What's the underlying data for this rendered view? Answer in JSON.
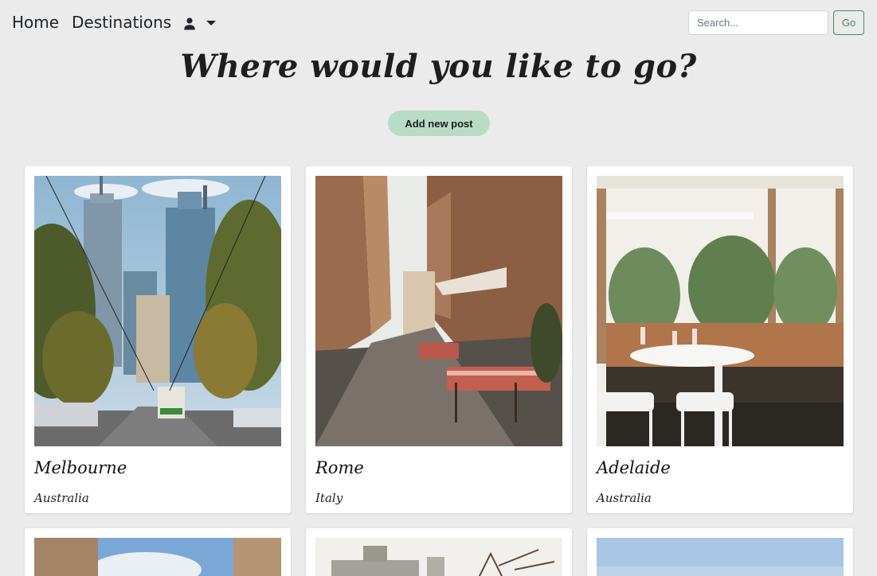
{
  "nav": {
    "home_label": "Home",
    "destinations_label": "Destinations",
    "user_icon": "person-icon",
    "caret_icon": "caret-down-icon"
  },
  "search": {
    "placeholder": "Search...",
    "value": "",
    "button_label": "Go"
  },
  "header": {
    "title": "Where would you like to go?",
    "add_post_label": "Add new post"
  },
  "colors": {
    "background": "#ebebeb",
    "accent_green": "#3f8f6a",
    "add_post_bg": "#b9dcc6"
  },
  "destinations": [
    {
      "title": "Melbourne",
      "country": "Australia"
    },
    {
      "title": "Rome",
      "country": "Italy"
    },
    {
      "title": "Adelaide",
      "country": "Australia"
    }
  ]
}
